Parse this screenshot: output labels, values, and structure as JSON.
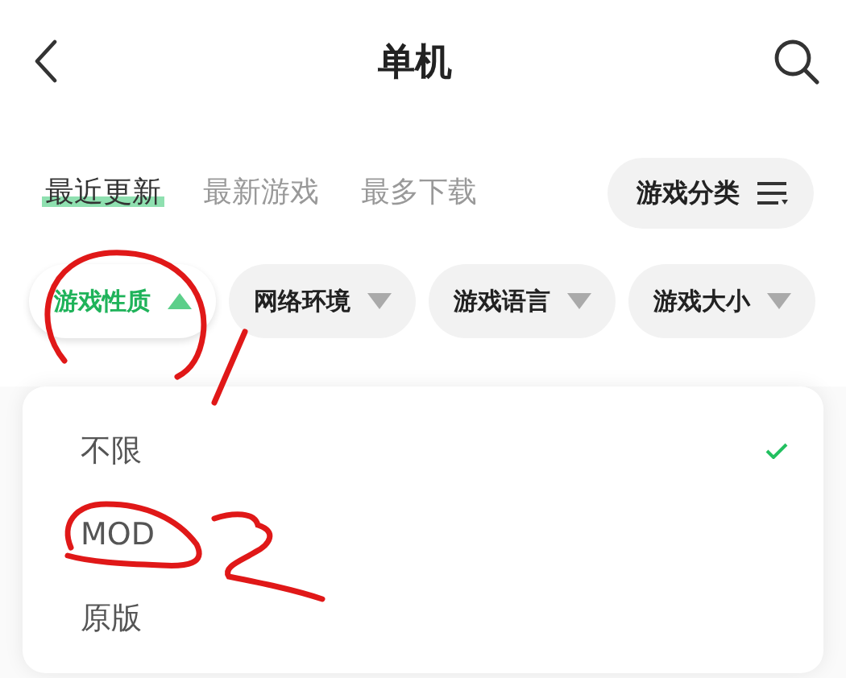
{
  "header": {
    "title": "单机"
  },
  "tabs": [
    {
      "label": "最近更新",
      "selected": true
    },
    {
      "label": "最新游戏",
      "selected": false
    },
    {
      "label": "最多下载",
      "selected": false
    }
  ],
  "category_button": {
    "label": "游戏分类"
  },
  "filters": [
    {
      "label": "游戏性质",
      "expanded": true
    },
    {
      "label": "网络环境",
      "expanded": false
    },
    {
      "label": "游戏语言",
      "expanded": false
    },
    {
      "label": "游戏大小",
      "expanded": false
    }
  ],
  "dropdown": {
    "options": [
      {
        "label": "不限",
        "selected": true
      },
      {
        "label": "MOD",
        "selected": false
      },
      {
        "label": "原版",
        "selected": false
      }
    ]
  }
}
